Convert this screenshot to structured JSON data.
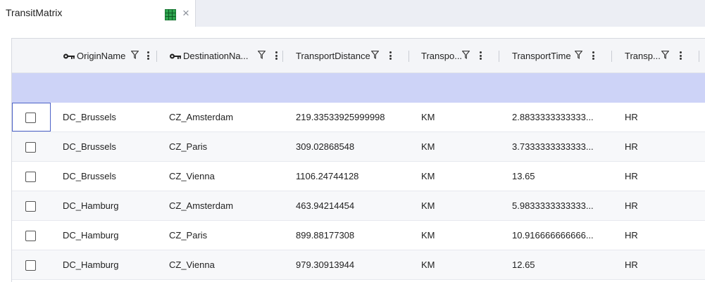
{
  "tab": {
    "title": "TransitMatrix",
    "close_label": "×"
  },
  "columns": [
    {
      "label": "OriginName",
      "key": true
    },
    {
      "label": "DestinationNa...",
      "key": true
    },
    {
      "label": "TransportDistance",
      "key": false
    },
    {
      "label": "Transpo...",
      "key": false
    },
    {
      "label": "TransportTime",
      "key": false
    },
    {
      "label": "Transp...",
      "key": false
    }
  ],
  "rows": [
    {
      "origin": "DC_Brussels",
      "destination": "CZ_Amsterdam",
      "distance": "219.33533925999998",
      "distance_unit": "KM",
      "time": "2.8833333333333...",
      "time_unit": "HR"
    },
    {
      "origin": "DC_Brussels",
      "destination": "CZ_Paris",
      "distance": "309.02868548",
      "distance_unit": "KM",
      "time": "3.7333333333333...",
      "time_unit": "HR"
    },
    {
      "origin": "DC_Brussels",
      "destination": "CZ_Vienna",
      "distance": "1106.24744128",
      "distance_unit": "KM",
      "time": "13.65",
      "time_unit": "HR"
    },
    {
      "origin": "DC_Hamburg",
      "destination": "CZ_Amsterdam",
      "distance": "463.94214454",
      "distance_unit": "KM",
      "time": "5.9833333333333...",
      "time_unit": "HR"
    },
    {
      "origin": "DC_Hamburg",
      "destination": "CZ_Paris",
      "distance": "899.88177308",
      "distance_unit": "KM",
      "time": "10.916666666666...",
      "time_unit": "HR"
    },
    {
      "origin": "DC_Hamburg",
      "destination": "CZ_Vienna",
      "distance": "979.30913944",
      "distance_unit": "KM",
      "time": "12.65",
      "time_unit": "HR"
    }
  ],
  "colors": {
    "filter_row": "#cdd3f7",
    "header_bg": "#f4f5f8",
    "focus_border": "#4d63c8",
    "grid_icon": "#2ea44f"
  },
  "icons": {
    "key": "key-icon",
    "filter": "filter-icon",
    "menu": "more-vertical-icon",
    "table": "table-grid-icon",
    "close": "close-icon"
  }
}
